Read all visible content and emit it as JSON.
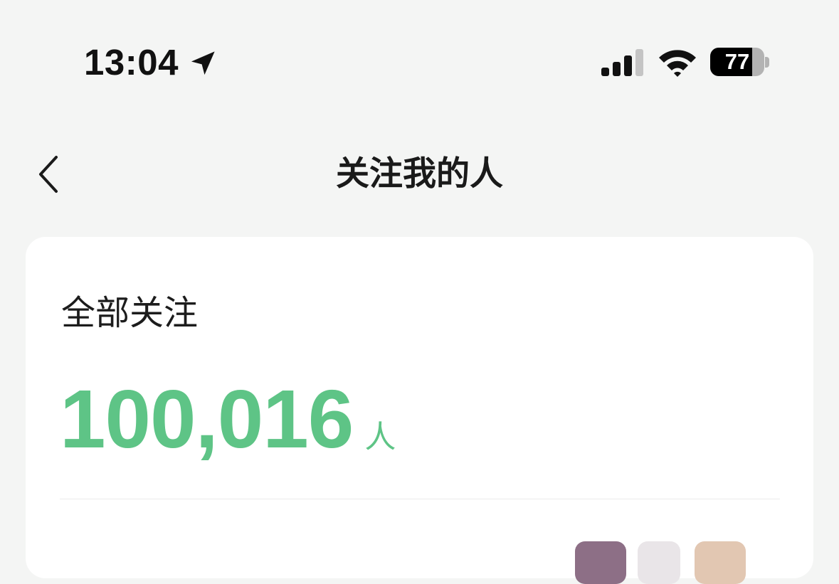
{
  "status_bar": {
    "time": "13:04",
    "location_icon": "location-arrow-icon",
    "signal_icon": "cellular-signal-icon",
    "wifi_icon": "wifi-icon",
    "battery_level": "77",
    "battery_fraction": 0.77
  },
  "nav": {
    "back_icon": "chevron-left-icon",
    "title": "关注我的人"
  },
  "summary": {
    "title": "全部关注",
    "count": "100,016",
    "unit": "人"
  },
  "colors": {
    "accent": "#5ec486",
    "background": "#f4f5f4",
    "card": "#ffffff"
  }
}
